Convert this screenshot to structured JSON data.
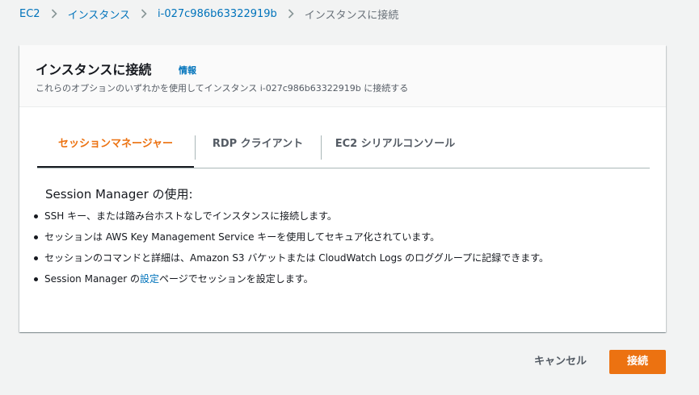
{
  "breadcrumb": {
    "items": [
      {
        "label": "EC2"
      },
      {
        "label": "インスタンス"
      },
      {
        "label": "i-027c986b63322919b"
      },
      {
        "label": "インスタンスに接続"
      }
    ]
  },
  "panel": {
    "title": "インスタンスに接続",
    "info_link": "情報",
    "description": "これらのオプションのいずれかを使用してインスタンス i-027c986b63322919b に接続する"
  },
  "tabs": [
    {
      "label": "セッションマネージャー",
      "active": true
    },
    {
      "label": "RDP クライアント",
      "active": false
    },
    {
      "label": "EC2 シリアルコンソール",
      "active": false
    }
  ],
  "content": {
    "heading": "Session Manager の使用:",
    "bullets": [
      "SSH キー、または踏み台ホストなしでインスタンスに接続します。",
      "セッションは AWS Key Management Service キーを使用してセキュア化されています。",
      "セッションのコマンドと詳細は、Amazon S3 バケットまたは CloudWatch Logs のロググループに記録できます。"
    ],
    "last_bullet": {
      "prefix": "Session Manager の",
      "link": "設定",
      "suffix": "ページでセッションを設定します。"
    }
  },
  "actions": {
    "cancel_label": "キャンセル",
    "connect_label": "接続"
  },
  "colors": {
    "accent": "#ec7211",
    "link": "#0073bb",
    "background": "#f2f3f3"
  },
  "icons": {
    "breadcrumb_separator": "chevron-right-icon"
  }
}
